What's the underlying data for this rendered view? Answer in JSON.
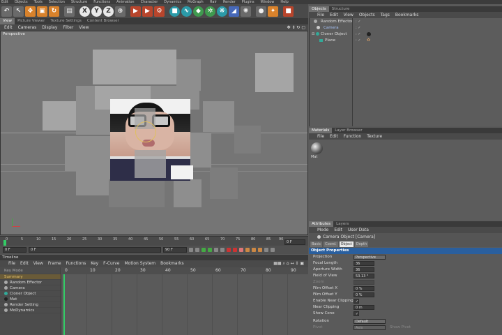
{
  "menubar": [
    "Edit",
    "Objects",
    "Tools",
    "Selection",
    "Structure",
    "Functions",
    "Animation",
    "Character",
    "Dynamics",
    "MoGraph",
    "Hair",
    "Render",
    "Plugins",
    "Window",
    "Help"
  ],
  "toolbar": {
    "colors": {
      "orange": "#d9822b",
      "teal": "#2b9aa8",
      "red": "#b8452c"
    }
  },
  "viewport": {
    "tabs": [
      "View",
      "Picture Viewer",
      "Texture Settings",
      "Content Browser"
    ],
    "menu": [
      "Edit",
      "Cameras",
      "Display",
      "Filter",
      "View"
    ],
    "label": "Perspective"
  },
  "ruler": {
    "ticks": [
      "0",
      "5",
      "10",
      "15",
      "20",
      "25",
      "30",
      "35",
      "40",
      "45",
      "50",
      "55",
      "60",
      "65",
      "70",
      "75",
      "80",
      "85",
      "90"
    ],
    "end_field": "0 F"
  },
  "transport": {
    "current": "0 F",
    "start": "0 F",
    "end": "90 F"
  },
  "timeline": {
    "title": "Timeline",
    "menu": [
      "File",
      "Edit",
      "View",
      "Frame",
      "Functions",
      "Key",
      "F-Curve",
      "Motion System",
      "Bookmarks"
    ],
    "mode": "Key Mode",
    "rows": [
      "Summary",
      "Random Effector",
      "Camera",
      "Cloner Object",
      "Mat",
      "Render Setting",
      "MoDynamics"
    ],
    "ruler": [
      "0",
      "10",
      "20",
      "30",
      "40",
      "50",
      "60",
      "70",
      "80",
      "90"
    ]
  },
  "objects": {
    "tabs": [
      "Objects",
      "Structure"
    ],
    "menu": [
      "File",
      "Edit",
      "View",
      "Objects",
      "Tags",
      "Bookmarks"
    ],
    "items": [
      "Random Effector",
      "Camera",
      "Cloner Object",
      "Plane"
    ]
  },
  "materials": {
    "tabs": [
      "Materials",
      "Layer Browser"
    ],
    "menu": [
      "File",
      "Edit",
      "Function",
      "Texture"
    ],
    "mat_name": "Mat"
  },
  "attributes": {
    "tabs": [
      "Attributes",
      "Layers"
    ],
    "menu": [
      "Mode",
      "Edit",
      "User Data"
    ],
    "header": "Camera Object [Camera]",
    "subtabs": [
      "Basic",
      "Coord.",
      "Object",
      "Depth"
    ],
    "section": "Object Properties",
    "rows": [
      {
        "label": "Projection",
        "value": "Perspective"
      },
      {
        "label": "Focal Length",
        "value": "36"
      },
      {
        "label": "Aperture Width",
        "value": "36"
      },
      {
        "label": "Field of View",
        "value": "53.13 °"
      },
      {
        "label": "Zoom",
        "value": ""
      },
      {
        "label": "Film Offset X",
        "value": "0 %"
      },
      {
        "label": "Film Offset Y",
        "value": "0 %"
      },
      {
        "label": "Enable Near Clipping",
        "value": "✓"
      },
      {
        "label": "Near Clipping",
        "value": "0 m"
      },
      {
        "label": "Show Cone",
        "value": "✓"
      },
      {
        "label": "Rotation",
        "value": "Default"
      },
      {
        "label": "Pivot",
        "value": "Axis"
      }
    ],
    "show_pivot": "Show Pivot"
  }
}
